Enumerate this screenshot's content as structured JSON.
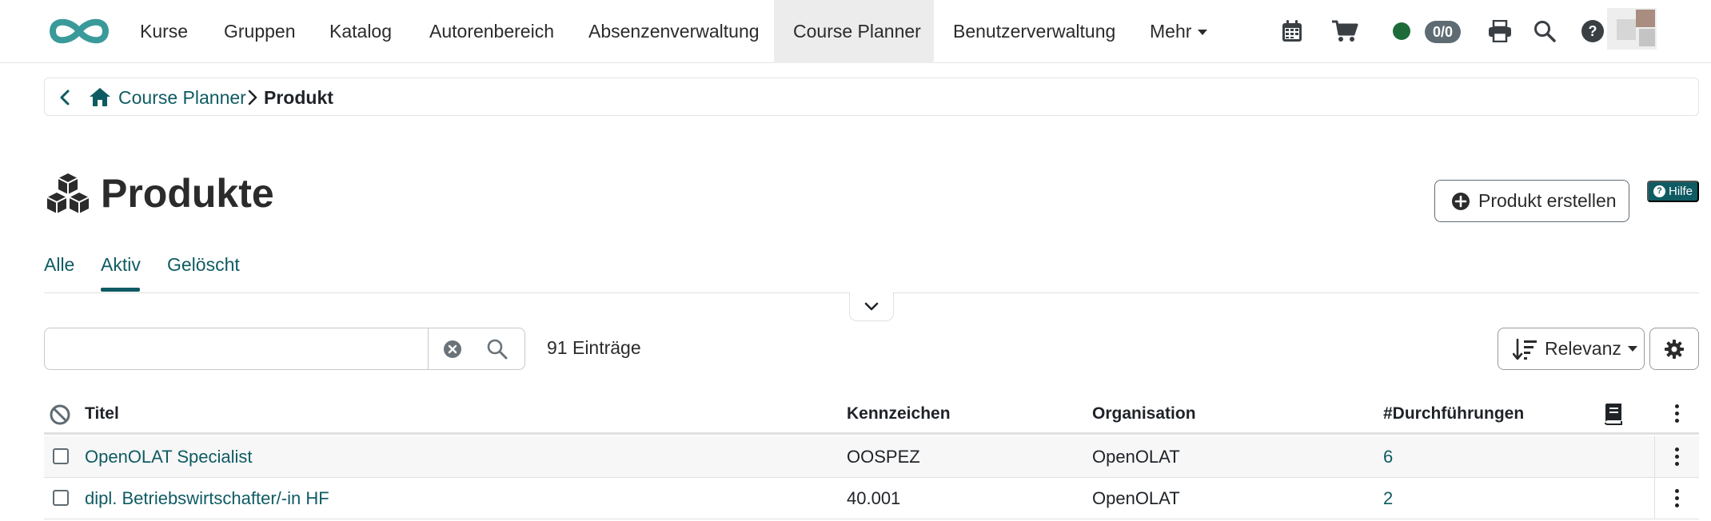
{
  "nav": {
    "items": [
      "Kurse",
      "Gruppen",
      "Katalog",
      "Autorenbereich",
      "Absenzenverwaltung",
      "Course Planner",
      "Benutzerverwaltung"
    ],
    "more_label": "Mehr",
    "active": "Course Planner",
    "badge_count": "0/0",
    "help_label": "?"
  },
  "breadcrumb": {
    "parent": "Course Planner",
    "current": "Produkt"
  },
  "page": {
    "title": "Produkte",
    "create_button": "Produkt erstellen",
    "help_button": "Hilfe"
  },
  "tabs": [
    "Alle",
    "Aktiv",
    "Gelöscht"
  ],
  "active_tab": "Aktiv",
  "search": {
    "value": "",
    "placeholder": ""
  },
  "entries_label": "91 Einträge",
  "sort_label": "Relevanz",
  "table": {
    "columns": {
      "title": "Titel",
      "code": "Kennzeichen",
      "organisation": "Organisation",
      "runs": "#Durchführungen"
    },
    "rows": [
      {
        "title": "OpenOLAT Specialist",
        "code": "OOSPEZ",
        "organisation": "OpenOLAT",
        "runs": "6"
      },
      {
        "title": "dipl. Betriebswirtschafter/-in HF",
        "code": "40.001",
        "organisation": "OpenOLAT",
        "runs": "2"
      }
    ]
  },
  "colors": {
    "accent": "#0f5b63",
    "status_dot": "#1e6b3a",
    "active_nav_bg": "#ececec"
  },
  "icons": {
    "logo": "infinity-logo",
    "nav": [
      "calendar-icon",
      "cart-icon",
      "status-dot",
      "print-icon",
      "search-icon",
      "help-icon"
    ],
    "page": "cubes-icon"
  }
}
